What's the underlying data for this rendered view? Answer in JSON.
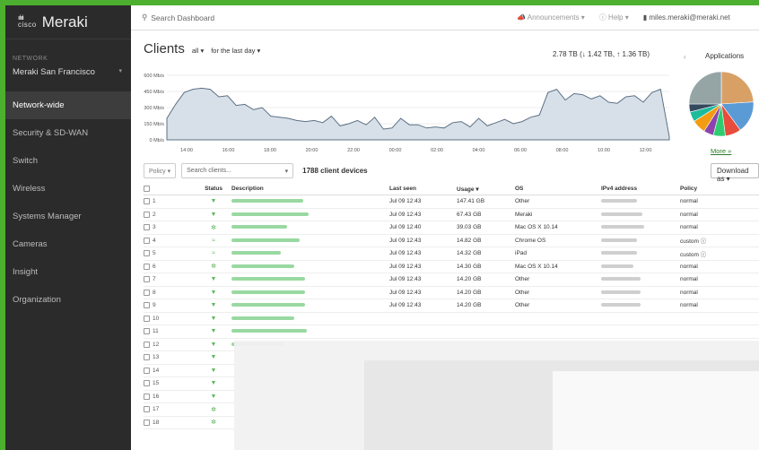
{
  "brand": {
    "cisco": "cisco",
    "name": "Meraki"
  },
  "sidebar": {
    "network_label": "NETWORK",
    "network_name": "Meraki San Francisco",
    "items": [
      {
        "label": "Network-wide",
        "active": true
      },
      {
        "label": "Security & SD-WAN",
        "active": false
      },
      {
        "label": "Switch",
        "active": false
      },
      {
        "label": "Wireless",
        "active": false
      },
      {
        "label": "Systems Manager",
        "active": false
      },
      {
        "label": "Cameras",
        "active": false
      },
      {
        "label": "Insight",
        "active": false
      },
      {
        "label": "Organization",
        "active": false
      }
    ]
  },
  "topbar": {
    "search_placeholder": "Search Dashboard",
    "announcements": "Announcements ▾",
    "help": "Help ▾",
    "user": "miles.meraki@meraki.net"
  },
  "clients": {
    "title": "Clients",
    "filter_all": "all ▾",
    "time_range": "for the last day ▾",
    "usage_total": "2.78 TB (↓ 1.42 TB, ↑ 1.36 TB)",
    "applications_title": "Applications",
    "more_link": "More »"
  },
  "chart_data": {
    "type": "area",
    "y_ticks": [
      "600 Mb/s",
      "450 Mb/s",
      "300 Mb/s",
      "150 Mb/s",
      "0 Mb/s"
    ],
    "ylim": [
      0,
      600
    ],
    "x_ticks": [
      "14:00",
      "16:00",
      "18:00",
      "20:00",
      "22:00",
      "00:00",
      "02:00",
      "04:00",
      "06:00",
      "08:00",
      "10:00",
      "12:00"
    ],
    "values": [
      200,
      330,
      440,
      470,
      480,
      470,
      400,
      410,
      320,
      330,
      280,
      300,
      220,
      210,
      200,
      180,
      170,
      180,
      160,
      220,
      130,
      150,
      180,
      140,
      210,
      100,
      110,
      200,
      140,
      140,
      110,
      120,
      110,
      160,
      170,
      120,
      200,
      130,
      160,
      190,
      150,
      170,
      210,
      230,
      440,
      470,
      370,
      430,
      420,
      380,
      410,
      350,
      340,
      400,
      410,
      350,
      440,
      470,
      30
    ]
  },
  "pie_colors": [
    "#d9a066",
    "#5b9bd5",
    "#e74c3c",
    "#2ecc71",
    "#8e44ad",
    "#f39c12",
    "#1abc9c",
    "#34495e",
    "#95a5a6"
  ],
  "toolbar": {
    "policy": "Policy ▾",
    "search_placeholder": "Search clients...",
    "device_count": "1788 client devices",
    "download": "Download as ▾"
  },
  "table": {
    "headers": {
      "status": "Status",
      "description": "Description",
      "last_seen": "Last seen",
      "usage": "Usage ▾",
      "os": "OS",
      "ipv4": "IPv4 address",
      "policy": "Policy",
      "plus": "+"
    },
    "rows": [
      {
        "num": "1",
        "status": "wired",
        "last_seen": "Jul 09 12:43",
        "usage": "147.41 GB",
        "os": "Other",
        "policy": "normal"
      },
      {
        "num": "2",
        "status": "wired",
        "last_seen": "Jul 09 12:43",
        "usage": "67.43 GB",
        "os": "Meraki",
        "policy": "normal"
      },
      {
        "num": "3",
        "status": "vpn",
        "last_seen": "Jul 09 12:40",
        "usage": "39.03 GB",
        "os": "Mac OS X 10.14",
        "policy": "normal"
      },
      {
        "num": "4",
        "status": "wifi",
        "last_seen": "Jul 09 12:43",
        "usage": "14.82 GB",
        "os": "Chrome OS",
        "policy": "custom"
      },
      {
        "num": "5",
        "status": "wifi",
        "last_seen": "Jul 09 12:43",
        "usage": "14.32 GB",
        "os": "iPad",
        "policy": "custom"
      },
      {
        "num": "6",
        "status": "vpn",
        "last_seen": "Jul 09 12:43",
        "usage": "14.30 GB",
        "os": "Mac OS X 10.14",
        "policy": "normal"
      },
      {
        "num": "7",
        "status": "wired",
        "last_seen": "Jul 09 12:43",
        "usage": "14.20 GB",
        "os": "Other",
        "policy": "normal"
      },
      {
        "num": "8",
        "status": "wired",
        "last_seen": "Jul 09 12:43",
        "usage": "14.20 GB",
        "os": "Other",
        "policy": "normal"
      },
      {
        "num": "9",
        "status": "wired",
        "last_seen": "Jul 09 12:43",
        "usage": "14.20 GB",
        "os": "Other",
        "policy": "normal"
      },
      {
        "num": "10",
        "status": "wired",
        "last_seen": "",
        "usage": "",
        "os": "",
        "policy": ""
      },
      {
        "num": "11",
        "status": "wired",
        "last_seen": "",
        "usage": "",
        "os": "",
        "policy": ""
      },
      {
        "num": "12",
        "status": "wired",
        "last_seen": "",
        "usage": "",
        "os": "",
        "policy": ""
      },
      {
        "num": "13",
        "status": "wired",
        "last_seen": "",
        "usage": "",
        "os": "",
        "policy": ""
      },
      {
        "num": "14",
        "status": "wired",
        "last_seen": "",
        "usage": "",
        "os": "",
        "policy": ""
      },
      {
        "num": "15",
        "status": "wired",
        "last_seen": "",
        "usage": "",
        "os": "",
        "policy": ""
      },
      {
        "num": "16",
        "status": "wired",
        "last_seen": "",
        "usage": "",
        "os": "",
        "policy": ""
      },
      {
        "num": "17",
        "status": "vpn",
        "last_seen": "",
        "usage": "",
        "os": "",
        "policy": ""
      },
      {
        "num": "18",
        "status": "vpn",
        "last_seen": "",
        "usage": "",
        "os": "",
        "policy": ""
      }
    ]
  }
}
